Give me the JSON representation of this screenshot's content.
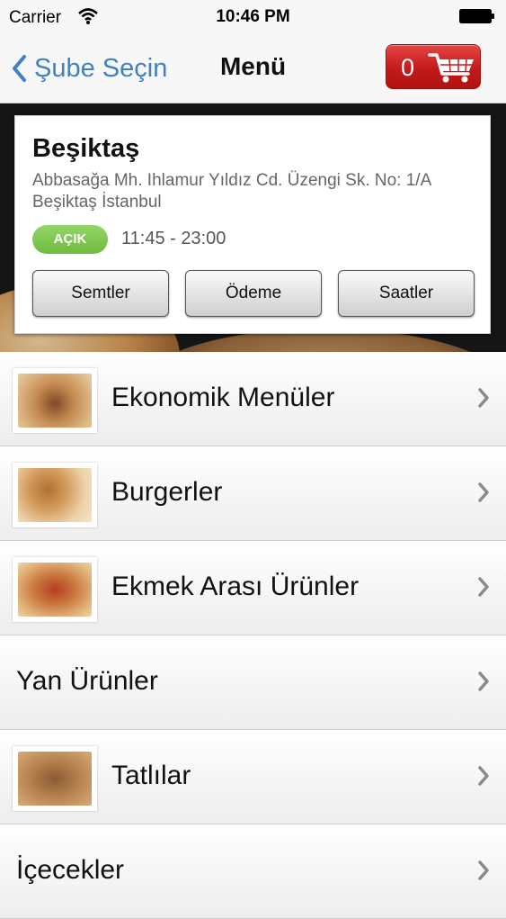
{
  "status_bar": {
    "carrier": "Carrier",
    "time": "10:46 PM"
  },
  "nav": {
    "back_label": "Şube Seçin",
    "title": "Menü",
    "cart_count": "0"
  },
  "branch": {
    "name": "Beşiktaş",
    "address": "Abbasağa Mh. Ihlamur Yıldız Cd. Üzengi Sk. No: 1/A Beşiktaş İstanbul",
    "status": "AÇIK",
    "hours": "11:45 - 23:00",
    "buttons": {
      "districts": "Semtler",
      "payment": "Ödeme",
      "hours": "Saatler"
    }
  },
  "categories": [
    {
      "label": "Ekonomik Menüler"
    },
    {
      "label": "Burgerler"
    },
    {
      "label": "Ekmek Arası Ürünler"
    },
    {
      "label": "Yan Ürünler"
    },
    {
      "label": "Tatlılar"
    },
    {
      "label": "İçecekler"
    }
  ],
  "colors": {
    "accent": "#3f82c4",
    "cart": "#c81e1e",
    "open_badge": "#7cc24a"
  }
}
